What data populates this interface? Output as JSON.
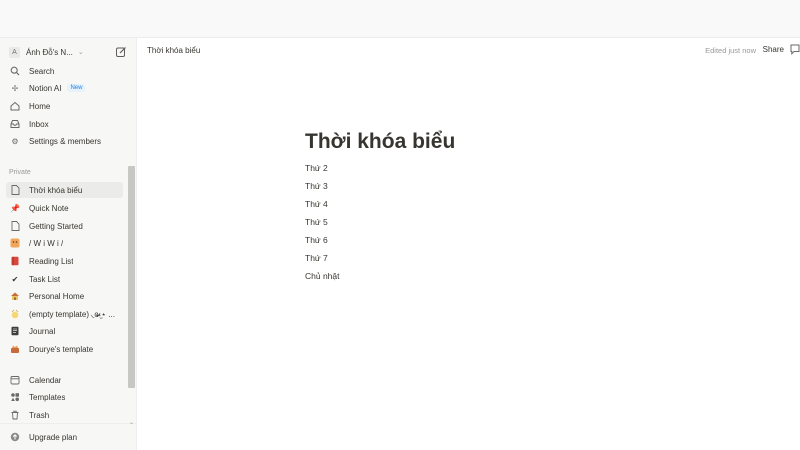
{
  "workspace": {
    "avatar_letter": "A",
    "name": "Ánh Đỗ's N..."
  },
  "sidebar": {
    "top_items": [
      {
        "label": "Search",
        "icon": "search-icon"
      },
      {
        "label": "Notion AI",
        "badge": "New",
        "icon": "notion-ai-icon"
      },
      {
        "label": "Home",
        "icon": "home-icon"
      },
      {
        "label": "Inbox",
        "icon": "inbox-icon"
      },
      {
        "label": "Settings & members",
        "icon": "gear-icon"
      }
    ],
    "section_label": "Private",
    "pages": [
      {
        "label": "Thời khóa biểu",
        "icon": "page-icon",
        "active": true
      },
      {
        "label": "Quick Note",
        "icon": "pushpin-icon"
      },
      {
        "label": "Getting Started",
        "icon": "page-icon"
      },
      {
        "label": "/ W i W i /",
        "icon": "emoji-icon"
      },
      {
        "label": "Reading List",
        "icon": "book-icon"
      },
      {
        "label": "Task List",
        "icon": "checkmark-icon"
      },
      {
        "label": "Personal Home",
        "icon": "house-emoji-icon"
      },
      {
        "label": "(empty template) ◟ɞ̴̶̷·̫⋆ ...",
        "icon": "emoji-icon"
      },
      {
        "label": "Journal",
        "icon": "journal-icon"
      },
      {
        "label": "Dourye's template",
        "icon": "emoji-icon"
      }
    ],
    "bottom_items": [
      {
        "label": "Calendar",
        "icon": "calendar-icon"
      },
      {
        "label": "Templates",
        "icon": "templates-icon"
      },
      {
        "label": "Trash",
        "icon": "trash-icon"
      }
    ],
    "upgrade_label": "Upgrade plan"
  },
  "header": {
    "breadcrumb": "Thời khóa biểu",
    "edited": "Edited just now",
    "share_label": "Share"
  },
  "page": {
    "title": "Thời khóa biểu",
    "lines": [
      "Thứ 2",
      "Thứ 3",
      "Thứ 4",
      "Thứ 5",
      "Thứ 6",
      "Thứ 7",
      "Chủ nhật"
    ]
  },
  "colors": {
    "accent": "#2383e2",
    "sidebar_bg": "#f7f7f5",
    "text": "#37352f"
  }
}
